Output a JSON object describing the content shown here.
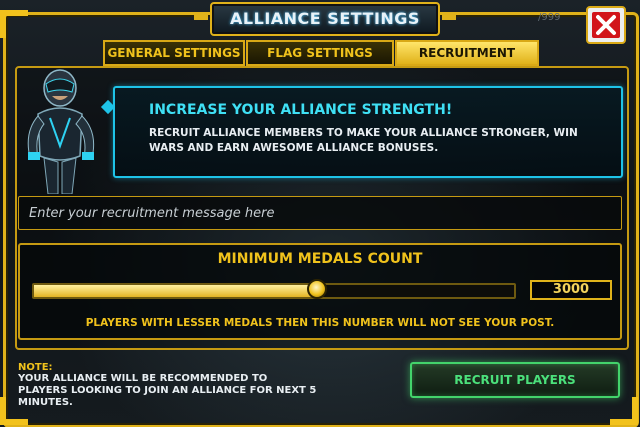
{
  "header": {
    "title": "ALLIANCE SETTINGS",
    "ghost_count": "/999"
  },
  "tabs": [
    {
      "label": "GENERAL SETTINGS",
      "active": false
    },
    {
      "label": "FLAG SETTINGS",
      "active": false
    },
    {
      "label": "RECRUITMENT",
      "active": true
    }
  ],
  "info": {
    "title": "INCREASE YOUR ALLIANCE STRENGTH!",
    "body": "RECRUIT ALLIANCE MEMBERS TO MAKE YOUR ALLIANCE STRONGER, WIN WARS AND EARN AWESOME ALLIANCE BONUSES."
  },
  "message": {
    "placeholder": "Enter your recruitment message here",
    "value": ""
  },
  "medals": {
    "title": "MINIMUM MEDALS COUNT",
    "value": "3000",
    "slider_fraction": 0.59,
    "note": "PLAYERS WITH LESSER MEDALS THEN THIS NUMBER WILL NOT SEE YOUR POST."
  },
  "footer": {
    "note_label": "NOTE:",
    "note_text": "YOUR ALLIANCE WILL BE RECOMMENDED TO PLAYERS LOOKING TO JOIN AN ALLIANCE FOR NEXT 5 MINUTES.",
    "recruit_label": "RECRUIT PLAYERS"
  },
  "colors": {
    "accent_yellow": "#f0c21c",
    "accent_cyan": "#1ec3e8",
    "button_green": "#43d36b",
    "close_red": "#d2141a"
  },
  "icons": {
    "close": "close-icon",
    "character": "character-portrait"
  }
}
